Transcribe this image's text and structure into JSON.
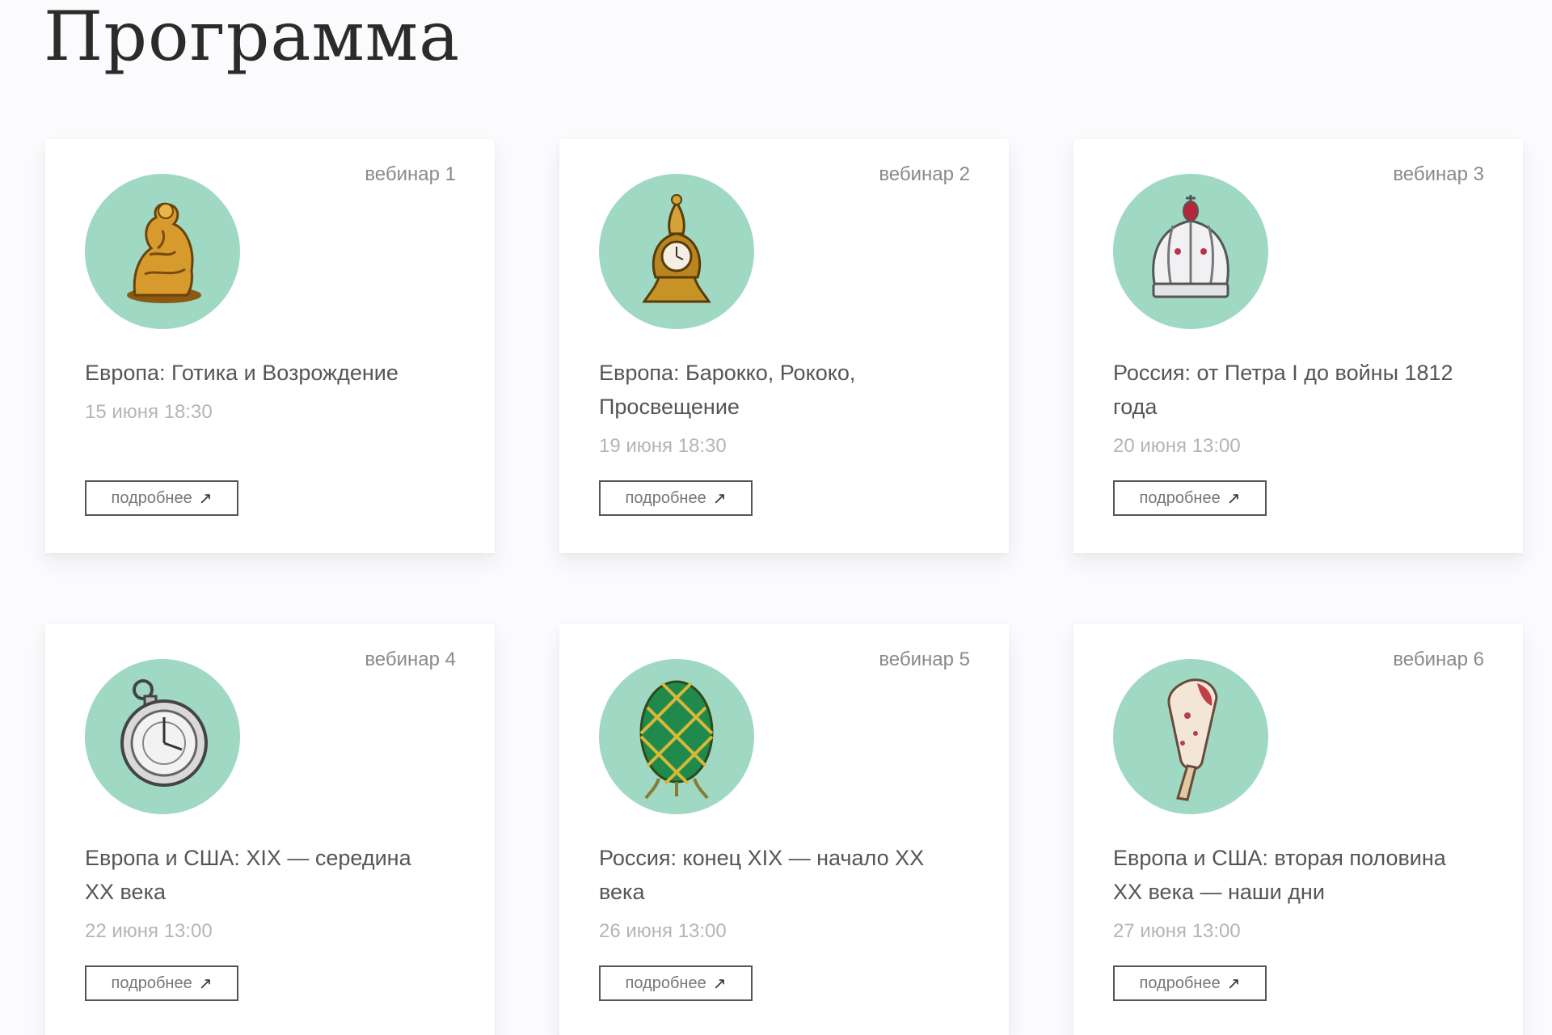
{
  "page": {
    "title": "Программа"
  },
  "button_label": "подробнее",
  "button_icon": "arrow-up-right-icon",
  "colors": {
    "image_circle": "#9fd9c4",
    "date_text": "#b5b5b5"
  },
  "cards": [
    {
      "label": "вебинар 1",
      "title": "Европа: Готика и Возрождение",
      "date": "15 июня 18:30",
      "icon": "gilded-figurine-icon"
    },
    {
      "label": "вебинар 2",
      "title": "Европа: Барокко, Рококо, Просвещение",
      "date": "19 июня 18:30",
      "icon": "mantel-clock-icon"
    },
    {
      "label": "вебинар 3",
      "title": "Россия: от Петра I до войны 1812 года",
      "date": "20 июня 13:00",
      "icon": "imperial-crown-icon"
    },
    {
      "label": "вебинар 4",
      "title": "Европа и США: XIX — середина XX века",
      "date": "22 июня 13:00",
      "icon": "pocket-watch-icon"
    },
    {
      "label": "вебинар 5",
      "title": "Россия: конец XIX — начало XX века",
      "date": "26 июня 13:00",
      "icon": "faberge-egg-icon"
    },
    {
      "label": "вебинар 6",
      "title": "Европа и США: вторая половина XX века — наши дни",
      "date": "27 июня 13:00",
      "icon": "ice-cream-icon"
    }
  ]
}
